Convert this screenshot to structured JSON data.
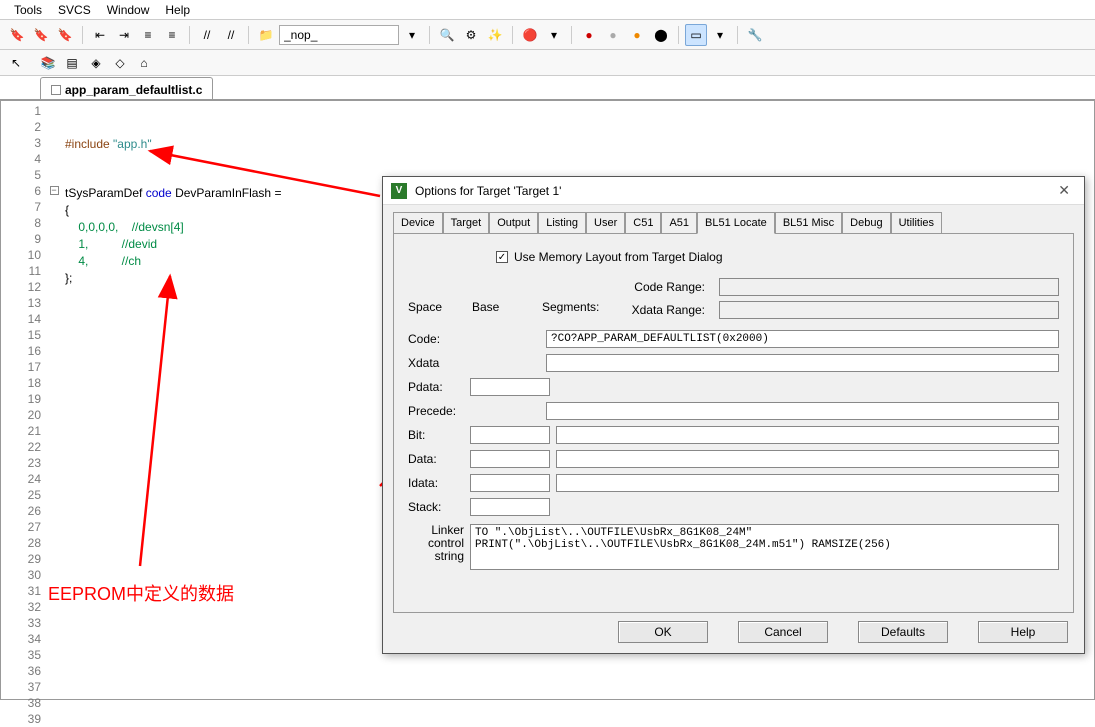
{
  "menu": [
    "Tools",
    "SVCS",
    "Window",
    "Help"
  ],
  "toolbar_nop": "_nop_",
  "tab_file": "app_param_defaultlist.c",
  "line_numbers": [
    "1",
    "2",
    "3",
    "4",
    "5",
    "6",
    "7",
    "8",
    "9",
    "10",
    "11",
    "12",
    "13",
    "14",
    "15",
    "16",
    "17",
    "18",
    "19",
    "20",
    "21",
    "22",
    "23",
    "24",
    "25",
    "26",
    "27",
    "28",
    "29",
    "30",
    "31",
    "32",
    "33",
    "34",
    "35",
    "36",
    "37",
    "38",
    "39"
  ],
  "code": {
    "l2a": "#include ",
    "l2b": "\"app.h\"",
    "l5a": "tSysParamDef ",
    "l5b": "code",
    "l5c": " DevParamInFlash =",
    "l6": "{",
    "l7a": "    0,0,0,0,",
    "l7b": "    //devsn[4]",
    "l8a": "    1,",
    "l8b": "          //devid",
    "l9a": "    4,",
    "l9b": "          //ch",
    "l10": "};"
  },
  "annotation": "EEPROM中定义的数据",
  "dialog": {
    "title": "Options for Target 'Target 1'",
    "tabs": [
      "Device",
      "Target",
      "Output",
      "Listing",
      "User",
      "C51",
      "A51",
      "BL51 Locate",
      "BL51 Misc",
      "Debug",
      "Utilities"
    ],
    "active_tab": 7,
    "use_memory_layout": "Use Memory Layout from Target Dialog",
    "code_range_lbl": "Code Range:",
    "xdata_range_lbl": "Xdata Range:",
    "code_range": "",
    "xdata_range": "",
    "col_space": "Space",
    "col_base": "Base",
    "col_segments": "Segments:",
    "rows": {
      "code_lbl": "Code:",
      "code_seg": "?CO?APP_PARAM_DEFAULTLIST(0x2000)",
      "xdata_lbl": "Xdata",
      "xdata_seg": "",
      "pdata_lbl": "Pdata:",
      "pdata_seg": "",
      "precede_lbl": "Precede:",
      "precede_seg": "",
      "bit_lbl": "Bit:",
      "bit_base": "",
      "bit_seg": "",
      "data_lbl": "Data:",
      "data_base": "",
      "data_seg": "",
      "idata_lbl": "Idata:",
      "idata_base": "",
      "idata_seg": "",
      "stack_lbl": "Stack:",
      "stack_base": "",
      "stack_seg": ""
    },
    "linker_lbl": "Linker\ncontrol\nstring",
    "linker_val": "TO \".\\ObjList\\..\\OUTFILE\\UsbRx_8G1K08_24M\"\nPRINT(\".\\ObjList\\..\\OUTFILE\\UsbRx_8G1K08_24M.m51\") RAMSIZE(256)",
    "btn_ok": "OK",
    "btn_cancel": "Cancel",
    "btn_defaults": "Defaults",
    "btn_help": "Help"
  }
}
